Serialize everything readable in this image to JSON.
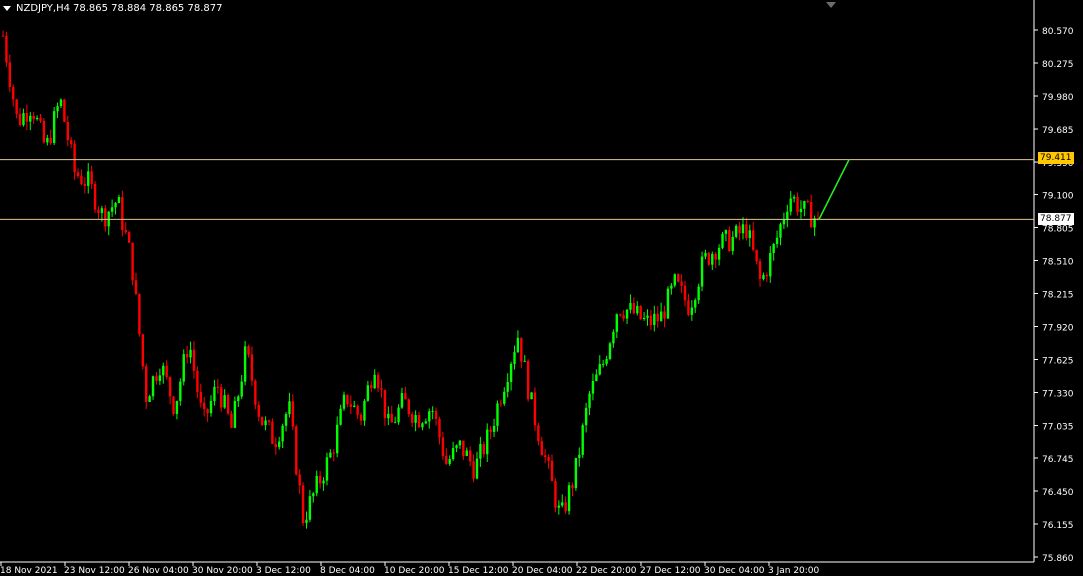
{
  "chart_header": {
    "symbol_timeframe": "NZDJPY,H4",
    "ohlc": "78.865 78.884 78.865 78.877"
  },
  "price_tags": {
    "alert_line": "79.411",
    "bid_line": "78.877"
  },
  "colors": {
    "background": "#000000",
    "bull": "#00ff00",
    "bear": "#ff0000",
    "horizontal_line": "#e0c890",
    "trend_line": "#22ee22",
    "axis": "#ffffff"
  },
  "chart_data": {
    "type": "candlestick",
    "ylim": [
      75.86,
      80.7
    ],
    "y_ticks": [
      "80.570",
      "80.275",
      "79.980",
      "79.685",
      "79.390",
      "79.100",
      "78.805",
      "78.510",
      "78.215",
      "77.920",
      "77.625",
      "77.330",
      "77.035",
      "76.745",
      "76.450",
      "76.155",
      "75.860"
    ],
    "x_ticks": [
      "18 Nov 2021",
      "23 Nov 12:00",
      "26 Nov 04:00",
      "30 Nov 20:00",
      "3 Dec 12:00",
      "8 Dec 04:00",
      "10 Dec 20:00",
      "15 Dec 12:00",
      "20 Dec 04:00",
      "22 Dec 20:00",
      "27 Dec 12:00",
      "30 Dec 04:00",
      "3 Jan 20:00"
    ],
    "horizontal_lines": [
      79.411,
      78.877
    ],
    "trend_line": [
      [
        78.877,
        0
      ],
      [
        79.411,
        1
      ]
    ],
    "close_path": [
      80.52,
      79.75,
      79.9,
      79.5,
      79.95,
      79.3,
      79.2,
      78.9,
      79.05,
      78.5,
      77.3,
      77.6,
      77.2,
      77.8,
      77.05,
      77.4,
      77.0,
      77.7,
      77.1,
      76.9,
      77.2,
      76.2,
      76.5,
      76.8,
      77.3,
      77.1,
      77.6,
      77.0,
      77.25,
      77.1,
      77.2,
      76.7,
      76.85,
      76.65,
      76.95,
      77.4,
      77.85,
      77.2,
      76.7,
      76.2,
      76.6,
      77.3,
      77.6,
      78.1,
      78.05,
      77.95,
      78.0,
      78.3,
      78.1,
      78.5,
      78.65,
      78.7,
      78.8,
      78.3,
      78.65,
      79.1,
      78.95,
      78.877
    ]
  }
}
